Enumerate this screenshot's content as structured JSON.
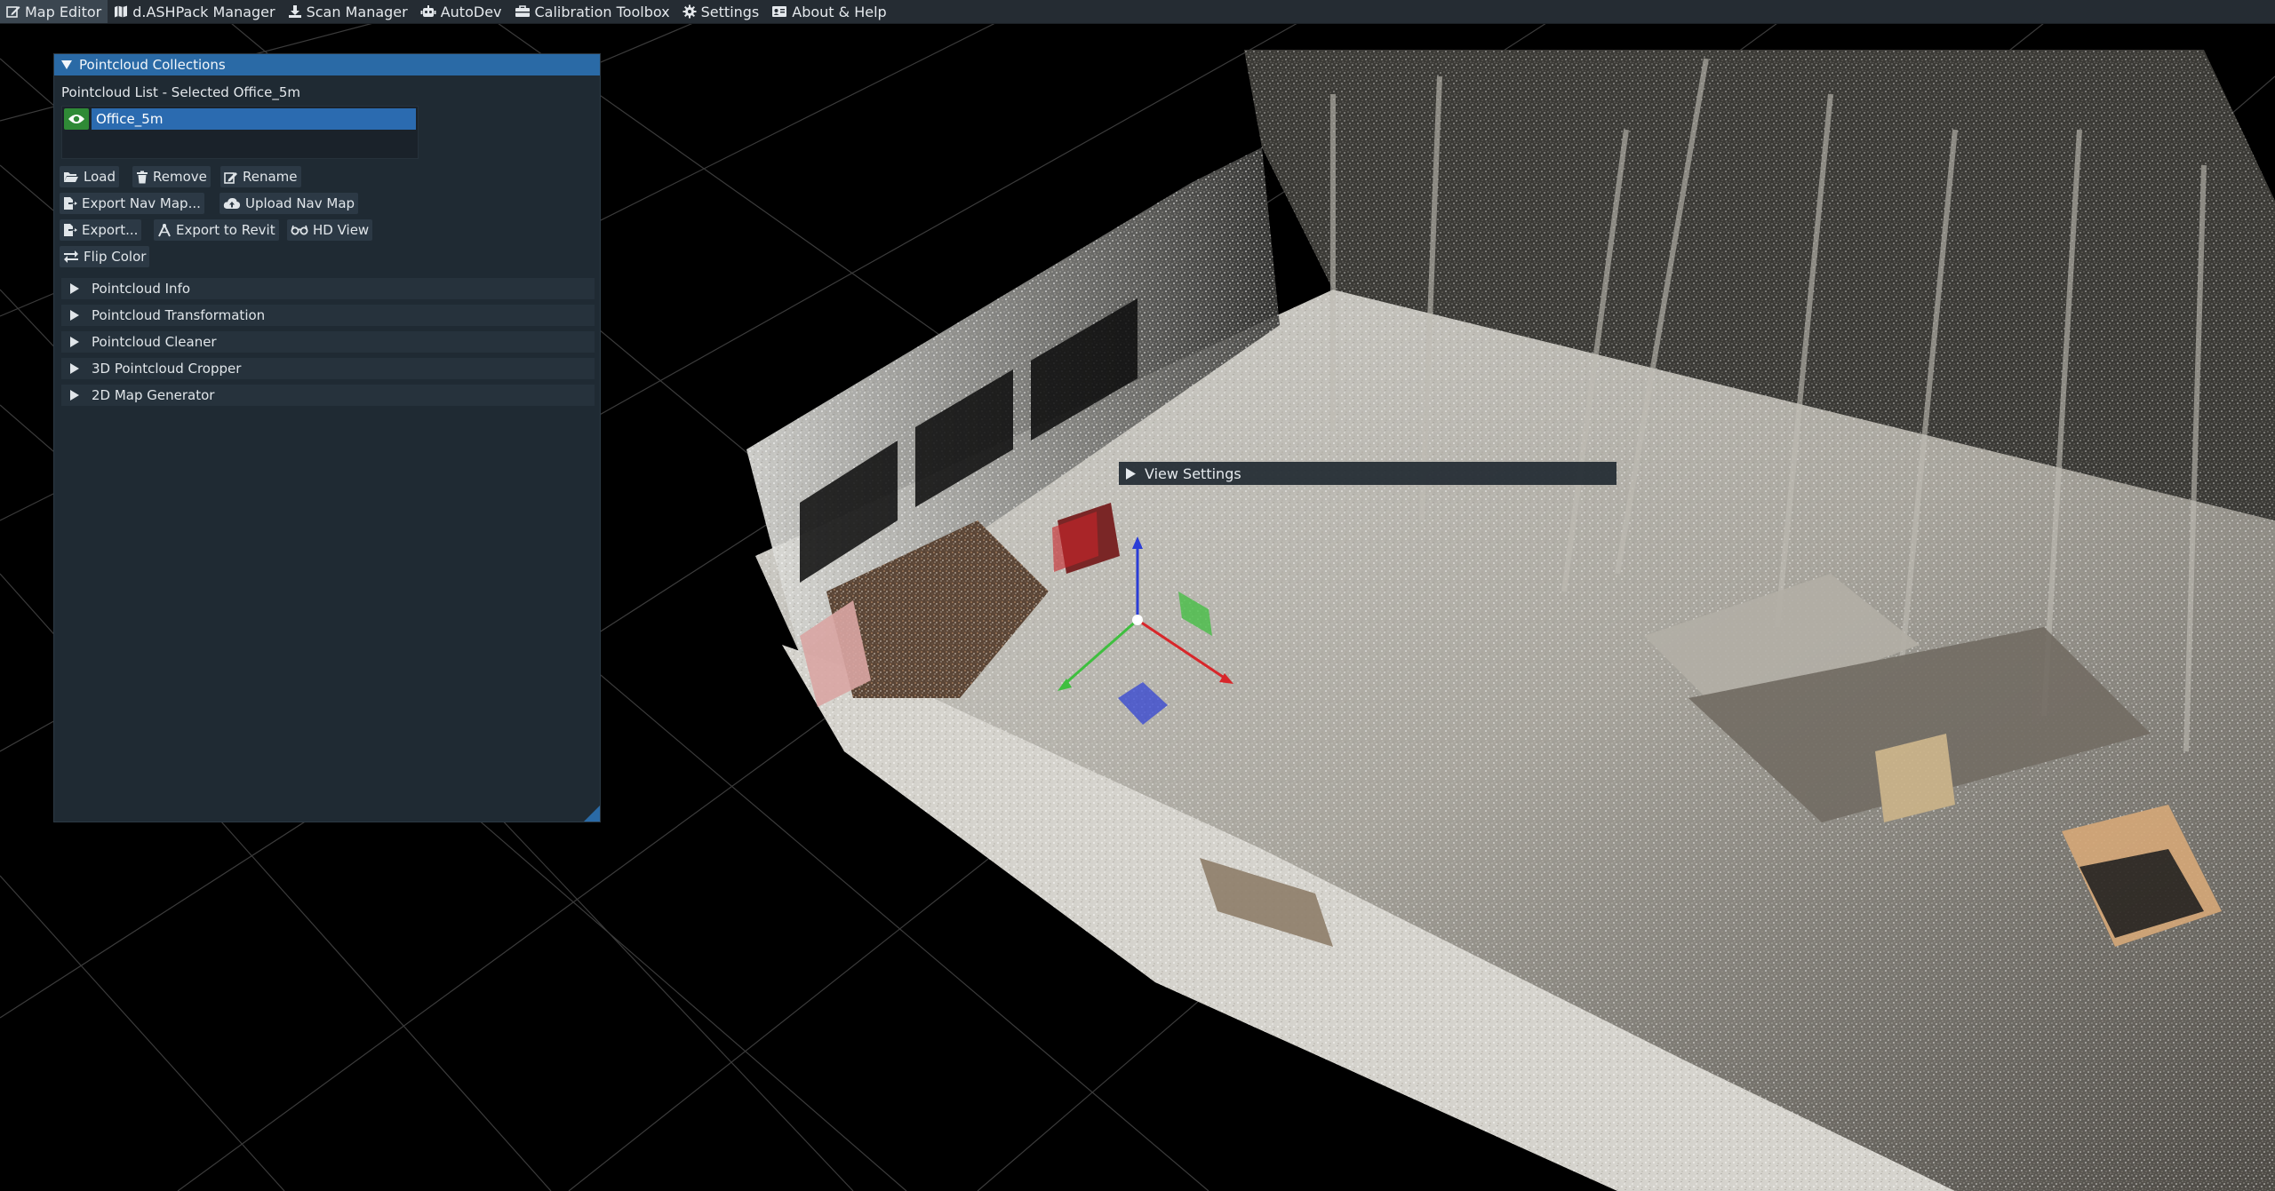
{
  "menu": [
    {
      "label": "Map Editor",
      "icon": "edit-icon",
      "active": true
    },
    {
      "label": "d.ASHPack Manager",
      "icon": "map-icon",
      "active": false
    },
    {
      "label": "Scan Manager",
      "icon": "download-icon",
      "active": false
    },
    {
      "label": "AutoDev",
      "icon": "robot-icon",
      "active": false
    },
    {
      "label": "Calibration Toolbox",
      "icon": "toolbox-icon",
      "active": false
    },
    {
      "label": "Settings",
      "icon": "gear-icon",
      "active": false
    },
    {
      "label": "About & Help",
      "icon": "id-card-icon",
      "active": false
    }
  ],
  "panel": {
    "title": "Pointcloud Collections",
    "list_caption": "Pointcloud List - Selected Office_5m",
    "items": [
      {
        "label": "Office_5m",
        "visible": true,
        "selected": true
      }
    ],
    "buttons": {
      "load": "Load",
      "remove": "Remove",
      "rename": "Rename",
      "export_nav_map": "Export Nav Map...",
      "upload_nav_map": "Upload Nav Map",
      "export": "Export...",
      "export_revit": "Export to Revit",
      "hd_view": "HD View",
      "flip_color": "Flip Color"
    },
    "sections": [
      {
        "label": "Pointcloud Info"
      },
      {
        "label": "Pointcloud Transformation"
      },
      {
        "label": "Pointcloud Cleaner"
      },
      {
        "label": "3D Pointcloud Cropper"
      },
      {
        "label": "2D Map Generator"
      }
    ]
  },
  "view_settings": {
    "label": "View Settings"
  },
  "colors": {
    "menubar": "#252c33",
    "panel_bg": "#1f2a33",
    "header": "#2a6aa6",
    "selection": "#2b6bb0",
    "visible_toggle": "#2f8a36",
    "gizmo_x": "#d8262a",
    "gizmo_y": "#3fbf3f",
    "gizmo_z": "#2a3cd6"
  }
}
